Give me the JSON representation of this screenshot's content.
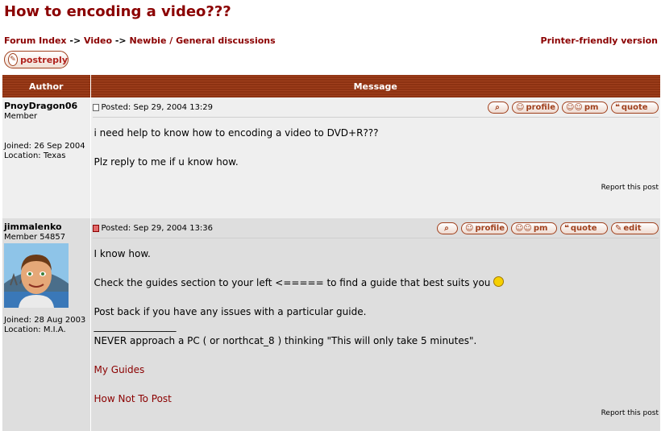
{
  "title": "How to encoding a video???",
  "breadcrumb": {
    "items": [
      "Forum Index",
      "Video",
      "Newbie / General discussions"
    ],
    "separator": "->"
  },
  "printer_link": "Printer-friendly version",
  "post_reply_label": "postreply",
  "table": {
    "author_header": "Author",
    "message_header": "Message"
  },
  "buttons": {
    "search": "search-icon",
    "profile": "profile",
    "pm": "pm",
    "quote": "quote",
    "edit": "edit"
  },
  "posts": [
    {
      "author": "PnoyDragon06",
      "rank": "Member",
      "joined": "Joined: 26 Sep 2004",
      "location": "Location: Texas",
      "posted": "Posted: Sep 29, 2004 13:29",
      "body": [
        "i need help to know how to encoding a video to DVD+R???",
        "Plz reply to me if u know how."
      ],
      "report": "Report this post"
    },
    {
      "author": "jimmalenko",
      "rank": "Member 54857",
      "joined": "Joined: 28 Aug 2003",
      "location": "Location: M.I.A.",
      "posted": "Posted: Sep 29, 2004 13:36",
      "body": [
        "I know how.",
        "Check the guides section to your left <===== to find a guide that best suits you",
        "Post back if you have any issues with a particular guide."
      ],
      "signature_line": "_________________",
      "signature_quote": "NEVER approach a PC ( or northcat_8 ) thinking \"This will only take 5 minutes\".",
      "links": [
        "My Guides",
        "How Not To Post"
      ],
      "report": "Report this post"
    }
  ],
  "colors": {
    "accent": "#8b0000",
    "header_bg": "#8d3212",
    "row1": "#efefef",
    "row2": "#dedede"
  }
}
